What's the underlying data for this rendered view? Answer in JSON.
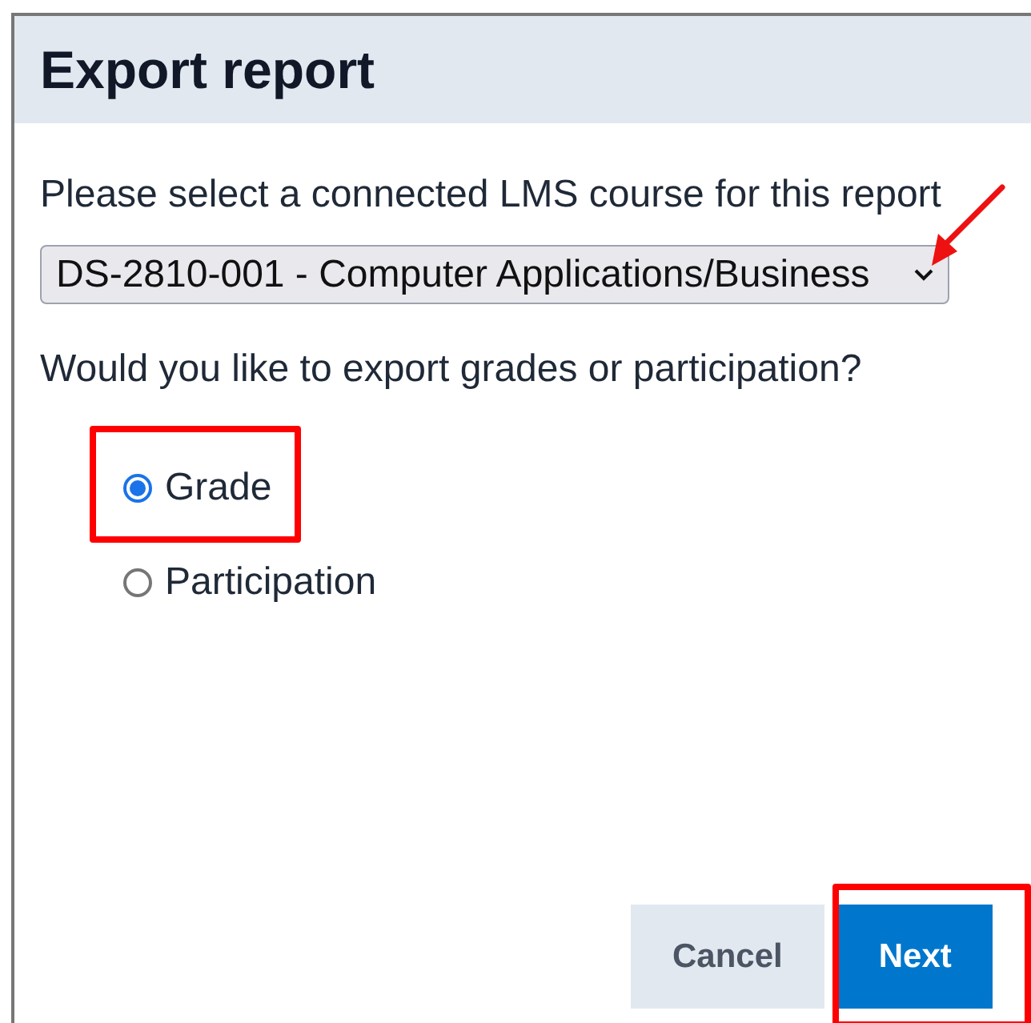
{
  "dialog": {
    "title": "Export report",
    "course_prompt": "Please select a connected LMS course for this report",
    "course_select": {
      "value": "DS-2810-001 - Computer Applications/Business"
    },
    "export_prompt": "Would you like to export grades or participation?",
    "export_options": [
      {
        "label": "Grade",
        "selected": true
      },
      {
        "label": "Participation",
        "selected": false
      }
    ],
    "buttons": [
      {
        "label": "Cancel",
        "kind": "secondary"
      },
      {
        "label": "Next",
        "kind": "primary"
      }
    ]
  }
}
